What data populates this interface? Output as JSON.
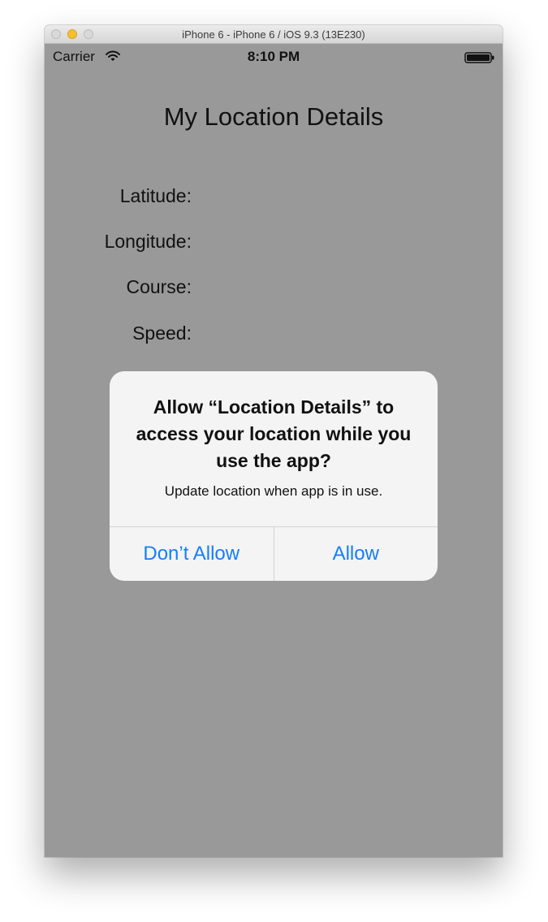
{
  "window": {
    "title": "iPhone 6 - iPhone 6 / iOS 9.3 (13E230)"
  },
  "status_bar": {
    "carrier": "Carrier",
    "time": "8:10 PM",
    "icons": [
      "wifi-icon",
      "battery-icon"
    ]
  },
  "screen": {
    "title": "My Location Details",
    "fields": [
      {
        "label": "Latitude:"
      },
      {
        "label": "Longitude:"
      },
      {
        "label": "Course:"
      },
      {
        "label": "Speed:"
      }
    ]
  },
  "alert": {
    "title": "Allow “Location Details” to access your location while you use the app?",
    "message": "Update location when app is in use.",
    "buttons": {
      "dont_allow": "Don’t Allow",
      "allow": "Allow"
    }
  },
  "colors": {
    "screen_background": "#999999",
    "alert_background": "#f4f4f4",
    "button_tint": "#147efb",
    "minimize_button": "#f5bf2f"
  }
}
